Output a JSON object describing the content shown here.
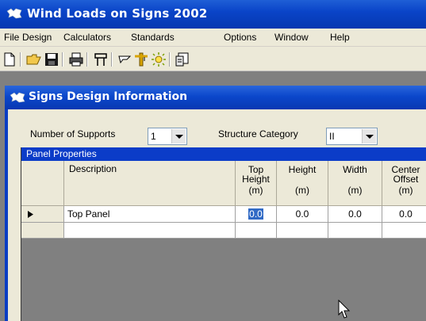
{
  "app": {
    "title": "Wind Loads on Signs 2002"
  },
  "menu": [
    "File",
    "Design",
    "Calculators",
    "Standards",
    "Options",
    "Window",
    "Help"
  ],
  "toolbar": {
    "icons": [
      "new-document-icon",
      "open-folder-icon",
      "save-disk-icon",
      "print-icon",
      "supports-icon",
      "sign-icon",
      "crane-icon",
      "light-icon",
      "report-icon"
    ]
  },
  "window": {
    "title": "Signs Design Information"
  },
  "form": {
    "supports_label": "Number of Supports",
    "supports_value": "1",
    "category_label": "Structure Category",
    "category_value": "II"
  },
  "panel": {
    "caption": "Panel Properties",
    "headers": {
      "description": "Description",
      "top_height_1": "Top",
      "top_height_2": "Height",
      "top_height_unit": "(m)",
      "height": "Height",
      "height_unit": "(m)",
      "width": "Width",
      "width_unit": "(m)",
      "center_1": "Center",
      "center_2": "Offset",
      "center_unit": "(m)"
    },
    "rows": [
      {
        "description": "Top Panel",
        "top_height": "0.0",
        "height": "0.0",
        "width": "0.0",
        "center": "0.0"
      }
    ]
  }
}
